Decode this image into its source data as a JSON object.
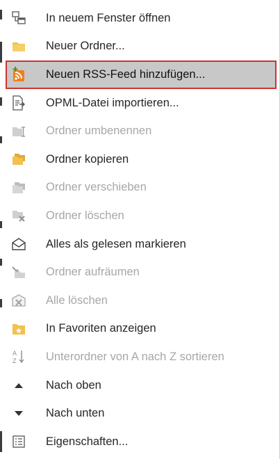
{
  "menu": {
    "items": [
      {
        "id": "open-new-window",
        "icon": "new-window-icon",
        "label": "In neuem Fenster öffnen",
        "disabled": false,
        "selected": false
      },
      {
        "id": "new-folder",
        "icon": "folder-icon",
        "label": "Neuer Ordner...",
        "disabled": false,
        "selected": false
      },
      {
        "id": "add-rss-feed",
        "icon": "rss-add-icon",
        "label": "Neuen RSS-Feed hinzufügen...",
        "disabled": false,
        "selected": true
      },
      {
        "id": "import-opml",
        "icon": "import-file-icon",
        "label": "OPML-Datei importieren...",
        "disabled": false,
        "selected": false
      },
      {
        "id": "rename-folder",
        "icon": "rename-folder-icon",
        "label": "Ordner umbenennen",
        "disabled": true,
        "selected": false
      },
      {
        "id": "copy-folder",
        "icon": "copy-folder-icon",
        "label": "Ordner kopieren",
        "disabled": false,
        "selected": false
      },
      {
        "id": "move-folder",
        "icon": "move-folder-icon",
        "label": "Ordner verschieben",
        "disabled": true,
        "selected": false
      },
      {
        "id": "delete-folder",
        "icon": "delete-folder-icon",
        "label": "Ordner löschen",
        "disabled": true,
        "selected": false
      },
      {
        "id": "mark-all-read",
        "icon": "open-envelope-icon",
        "label": "Alles als gelesen markieren",
        "disabled": false,
        "selected": false
      },
      {
        "id": "clean-up-folder",
        "icon": "cleanup-icon",
        "label": "Ordner aufräumen",
        "disabled": true,
        "selected": false
      },
      {
        "id": "delete-all",
        "icon": "delete-all-icon",
        "label": "Alle löschen",
        "disabled": true,
        "selected": false
      },
      {
        "id": "show-in-favorites",
        "icon": "favorite-folder-icon",
        "label": "In Favoriten anzeigen",
        "disabled": false,
        "selected": false
      },
      {
        "id": "sort-subfolders",
        "icon": "sort-az-icon",
        "label": "Unterordner von A nach Z sortieren",
        "disabled": true,
        "selected": false
      },
      {
        "id": "move-up",
        "icon": "triangle-up-icon",
        "label": "Nach oben",
        "disabled": false,
        "selected": false
      },
      {
        "id": "move-down",
        "icon": "triangle-down-icon",
        "label": "Nach unten",
        "disabled": false,
        "selected": false
      },
      {
        "id": "properties",
        "icon": "properties-icon",
        "label": "Eigenschaften...",
        "disabled": false,
        "selected": false
      }
    ]
  },
  "colors": {
    "selected_background": "#c8c8c8",
    "selected_border": "#d0312d",
    "text": "#262626",
    "disabled_text": "#a7a7a7",
    "folder": "#f2c14e",
    "rss": "#f07f1a"
  }
}
